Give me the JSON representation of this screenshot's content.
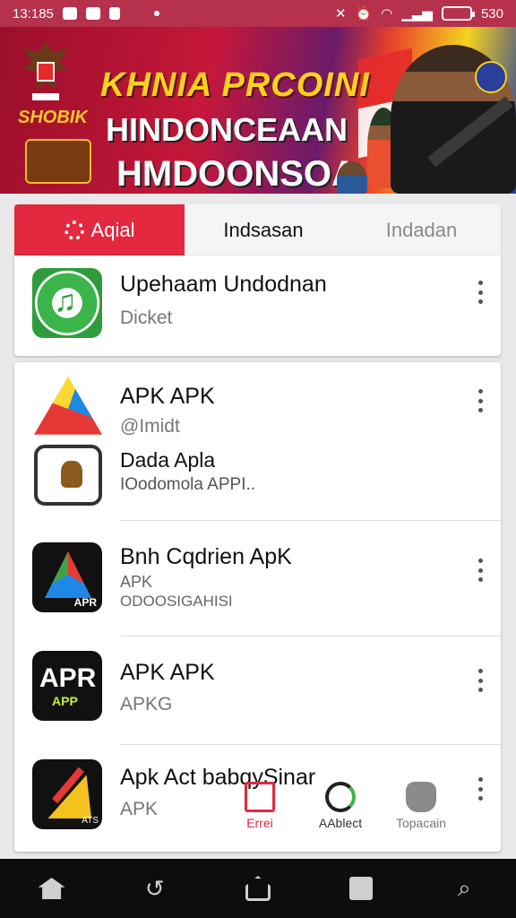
{
  "status_bar": {
    "time": "13:185",
    "battery": "530"
  },
  "banner": {
    "title_line1": "KHNIA PRCOINI",
    "title_line2": "HINDONCEAAN",
    "title_line3": "HMDOONSOA",
    "left_tag": "SHOBIK"
  },
  "tabs": [
    {
      "label": "Aqial",
      "active": true
    },
    {
      "label": "Indsasan",
      "active": false
    },
    {
      "label": "Indadan",
      "active": false
    }
  ],
  "featured": {
    "name": "Upehaam Undodnan",
    "subtitle": "Dicket",
    "icon": "music-note-icon"
  },
  "apps": [
    {
      "name": "APK APK",
      "subtitle": "@Imidt",
      "icon": "apk-triangle-icon"
    },
    {
      "name": "Dada Apla",
      "subtitle": "IOodomola APPI..",
      "icon": "shield-crest-icon"
    },
    {
      "name": "Bnh Cqdrien ApK",
      "subtitle": "APK",
      "subtitle2": "ODOOSIGAHISI",
      "icon": "apr-triangle-icon",
      "icon_label": "APR"
    },
    {
      "name": "APK APK",
      "subtitle": "APKG",
      "icon": "apr-app-icon",
      "icon_label": "APR",
      "icon_label2": "APP"
    },
    {
      "name": "Apk Act babqySinar",
      "subtitle": "APK",
      "icon": "pen-triangle-icon",
      "icon_label": "ATS"
    }
  ],
  "overlay_nav": [
    {
      "label": "Errei",
      "icon": "calendar-icon"
    },
    {
      "label": "AAblect",
      "icon": "refresh-icon"
    },
    {
      "label": "Topacain",
      "icon": "shield-icon"
    }
  ],
  "colors": {
    "accent": "#e3283f",
    "status_bar": "#b5314c",
    "nav_bar": "#0d0d0d"
  }
}
